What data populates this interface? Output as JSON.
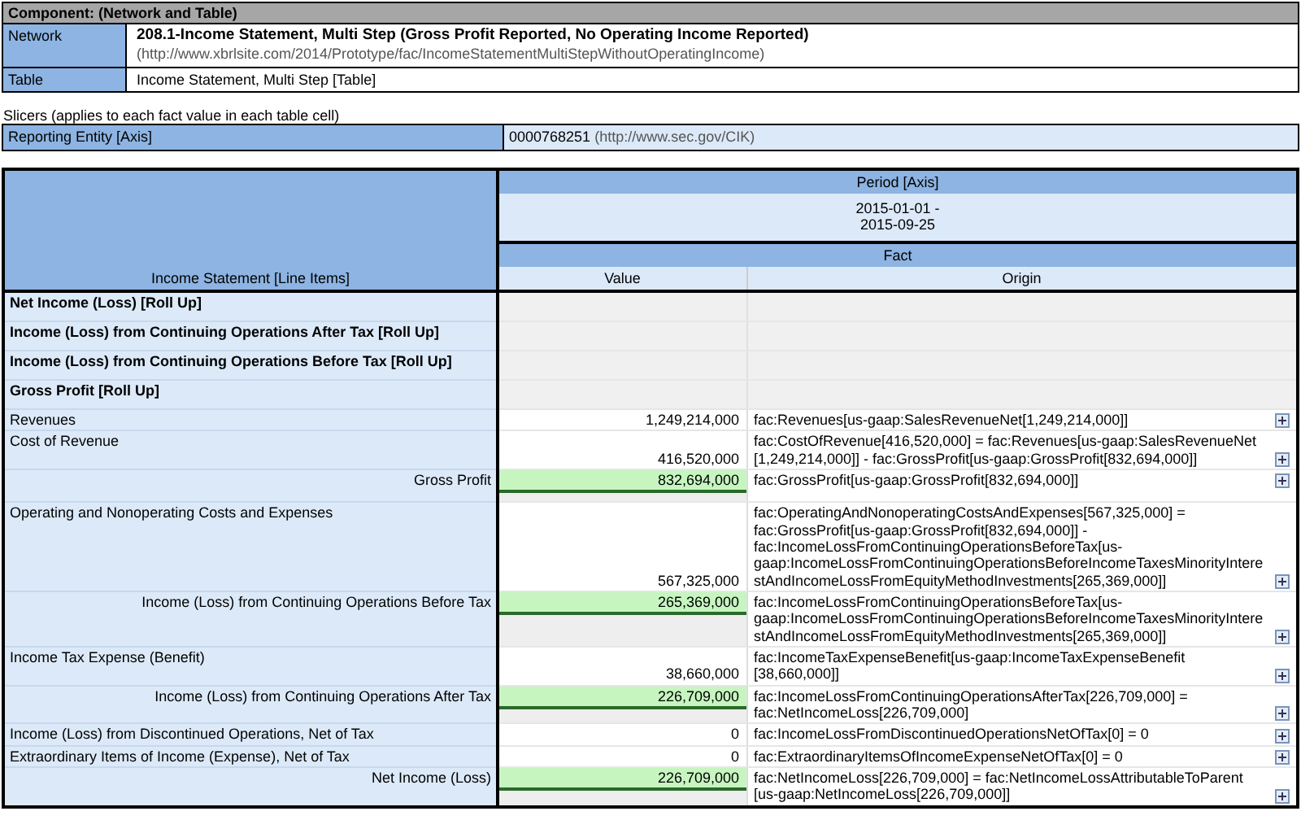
{
  "component": {
    "title": "Component: (Network and Table)",
    "network": {
      "label": "Network",
      "name": "208.1-Income Statement, Multi Step (Gross Profit Reported, No Operating Income Reported)",
      "url": "(http://www.xbrlsite.com/2014/Prototype/fac/IncomeStatementMultiStepWithoutOperatingIncome)"
    },
    "table": {
      "label": "Table",
      "name": "Income Statement, Multi Step [Table]"
    }
  },
  "slicers": {
    "caption": "Slicers (applies to each fact value in each table cell)",
    "axis": "Reporting Entity [Axis]",
    "value": "0000768251",
    "url": "(http://www.sec.gov/CIK)"
  },
  "grid": {
    "row_header": "Income Statement [Line Items]",
    "period_axis": "Period [Axis]",
    "period_start": "2015-01-01 -",
    "period_end": "2015-09-25",
    "fact": "Fact",
    "value_header": "Value",
    "origin_header": "Origin",
    "rows": [
      {
        "kind": "rollup",
        "label": "Net Income (Loss) [Roll Up]"
      },
      {
        "kind": "rollup",
        "label": "Income (Loss) from Continuing Operations After Tax [Roll Up]"
      },
      {
        "kind": "rollup",
        "label": "Income (Loss) from Continuing Operations Before Tax [Roll Up]"
      },
      {
        "kind": "rollup",
        "label": "Gross Profit [Roll Up]"
      },
      {
        "kind": "item",
        "label": "Revenues",
        "value": "1,249,214,000",
        "origin": "fac:Revenues[us-gaap:SalesRevenueNet[1,249,214,000]]"
      },
      {
        "kind": "item",
        "label": "Cost of Revenue",
        "value": "416,520,000",
        "origin": "fac:CostOfRevenue[416,520,000] = fac:Revenues[us-gaap:SalesRevenueNet [1,249,214,000]] - fac:GrossProfit[us-gaap:GrossProfit[832,694,000]]"
      },
      {
        "kind": "total",
        "label": "Gross Profit",
        "value": "832,694,000",
        "origin": "fac:GrossProfit[us-gaap:GrossProfit[832,694,000]]"
      },
      {
        "kind": "item",
        "label": "Operating and Nonoperating Costs and Expenses",
        "value": "567,325,000",
        "origin": "fac:OperatingAndNonoperatingCostsAndExpenses[567,325,000] = fac:GrossProfit[us-gaap:GrossProfit[832,694,000]] - fac:IncomeLossFromContinuingOperationsBeforeTax[us-gaap:IncomeLossFromContinuingOperationsBeforeIncomeTaxesMinorityInterestAndIncomeLossFromEquityMethodInvestments[265,369,000]]"
      },
      {
        "kind": "total",
        "label": "Income (Loss) from Continuing Operations Before Tax",
        "value": "265,369,000",
        "origin": "fac:IncomeLossFromContinuingOperationsBeforeTax[us-gaap:IncomeLossFromContinuingOperationsBeforeIncomeTaxesMinorityInterestAndIncomeLossFromEquityMethodInvestments[265,369,000]]"
      },
      {
        "kind": "item",
        "label": "Income Tax Expense (Benefit)",
        "value": "38,660,000",
        "origin": "fac:IncomeTaxExpenseBenefit[us-gaap:IncomeTaxExpenseBenefit [38,660,000]]"
      },
      {
        "kind": "total",
        "label": "Income (Loss) from Continuing Operations After Tax",
        "value": "226,709,000",
        "origin": "fac:IncomeLossFromContinuingOperationsAfterTax[226,709,000] = fac:NetIncomeLoss[226,709,000]"
      },
      {
        "kind": "item",
        "label": "Income (Loss) from Discontinued Operations, Net of Tax",
        "value": "0",
        "origin": "fac:IncomeLossFromDiscontinuedOperationsNetOfTax[0] = 0"
      },
      {
        "kind": "item",
        "label": "Extraordinary Items of Income (Expense), Net of Tax",
        "value": "0",
        "origin": "fac:ExtraordinaryItemsOfIncomeExpenseNetOfTax[0] = 0"
      },
      {
        "kind": "total",
        "label": "Net Income (Loss)",
        "value": "226,709,000",
        "origin": "fac:NetIncomeLoss[226,709,000] = fac:NetIncomeLossAttributableToParent [us-gaap:NetIncomeLoss[226,709,000]]"
      }
    ]
  }
}
